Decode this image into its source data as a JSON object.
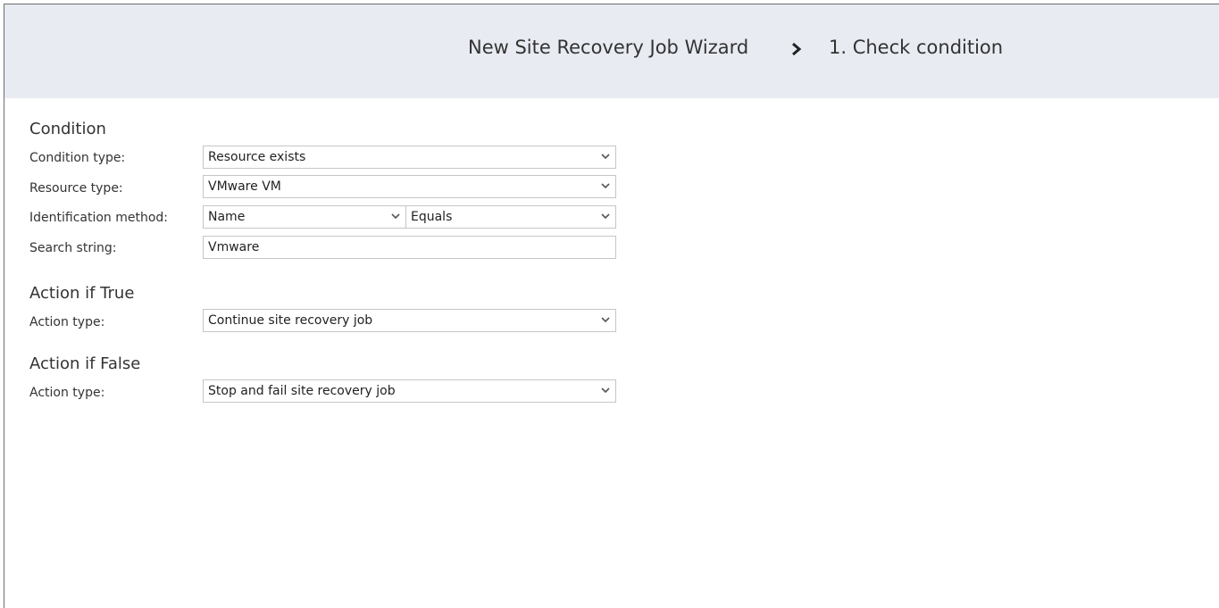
{
  "header": {
    "wizard_title": "New Site Recovery Job Wizard",
    "separator_icon": "chevron-right-icon",
    "step_label": "1. Check condition"
  },
  "condition": {
    "section_title": "Condition",
    "condition_type": {
      "label": "Condition type:",
      "value": "Resource exists"
    },
    "resource_type": {
      "label": "Resource type:",
      "value": "VMware VM"
    },
    "identification_method": {
      "label": "Identification method:",
      "method_value": "Name",
      "operator_value": "Equals"
    },
    "search_string": {
      "label": "Search string:",
      "value": "Vmware"
    }
  },
  "action_true": {
    "section_title": "Action if True",
    "action_type": {
      "label": "Action type:",
      "value": "Continue site recovery job"
    }
  },
  "action_false": {
    "section_title": "Action if False",
    "action_type": {
      "label": "Action type:",
      "value": "Stop and fail site recovery job"
    }
  },
  "colors": {
    "header_bg": "#e8ebf2",
    "border": "#c6c6c6",
    "text": "#333333"
  }
}
